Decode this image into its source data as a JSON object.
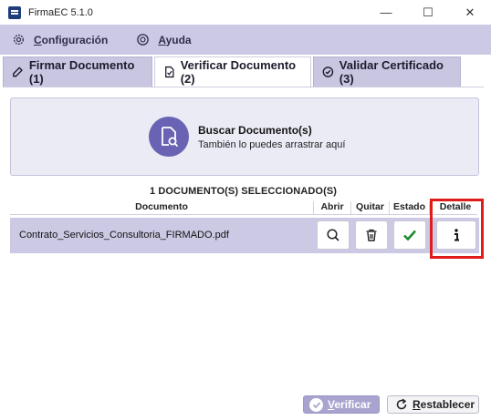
{
  "window": {
    "title": "FirmaEC 5.1.0",
    "minimize": "—",
    "maximize": "☐",
    "close": "✕"
  },
  "menu": {
    "items": [
      {
        "label": "Configuración",
        "icon": "gear-icon"
      },
      {
        "label": "Ayuda",
        "icon": "help-icon"
      }
    ]
  },
  "tabs": [
    {
      "label": "Firmar Documento (1)",
      "icon": "sign-document-icon",
      "active": false
    },
    {
      "label": "Verificar Documento (2)",
      "icon": "verify-document-icon",
      "active": true
    },
    {
      "label": "Validar Certificado (3)",
      "icon": "certificate-check-icon",
      "active": false
    }
  ],
  "dropzone": {
    "title": "Buscar Documento(s)",
    "subtitle": "También lo puedes arrastrar aquí",
    "icon": "search-document-icon",
    "icon_color": "#6a63b4"
  },
  "selection_count": "1 DOCUMENTO(S) SELECCIONADO(S)",
  "table": {
    "headers": {
      "documento": "Documento",
      "abrir": "Abrir",
      "quitar": "Quitar",
      "estado": "Estado",
      "detalle": "Detalle"
    },
    "rows": [
      {
        "name": "Contrato_Servicios_Consultoria_FIRMADO.pdf",
        "estado": "valid",
        "estado_color": "#1a8a2a"
      }
    ]
  },
  "actions": {
    "verificar": "Verificar",
    "restablecer": "Restablecer"
  },
  "colors": {
    "accent": "#ccc9e4",
    "highlight": "#e01b1b"
  }
}
